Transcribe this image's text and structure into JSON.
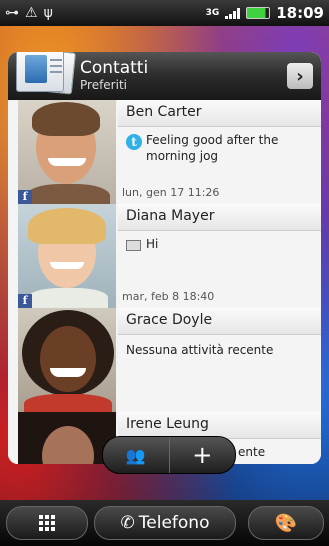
{
  "status_bar": {
    "time": "18:09",
    "network": "3G",
    "icons": [
      "usb-debug-icon",
      "warning-icon",
      "usb-icon",
      "signal-icon",
      "battery-icon"
    ]
  },
  "widget": {
    "title": "Contatti",
    "subtitle": "Preferiti",
    "contacts": [
      {
        "name": "Ben Carter",
        "status": "Feeling good after the morning jog",
        "source": "twitter",
        "time": "lun, gen 17 11:26",
        "facebook": true
      },
      {
        "name": "Diana Mayer",
        "status": "Hi",
        "source": "mail",
        "time": "mar, feb 8 18:40",
        "facebook": true
      },
      {
        "name": "Grace Doyle",
        "status": "Nessuna attività recente",
        "source": "",
        "time": "",
        "facebook": false
      },
      {
        "name": "Irene Leung",
        "status": "ente",
        "source": "",
        "time": "",
        "facebook": false
      }
    ]
  },
  "dock": {
    "phone_label": "Telefono"
  },
  "colors": {
    "facebook": "#3b5998",
    "twitter": "#2fb0e6",
    "battery": "#3fd13f"
  }
}
